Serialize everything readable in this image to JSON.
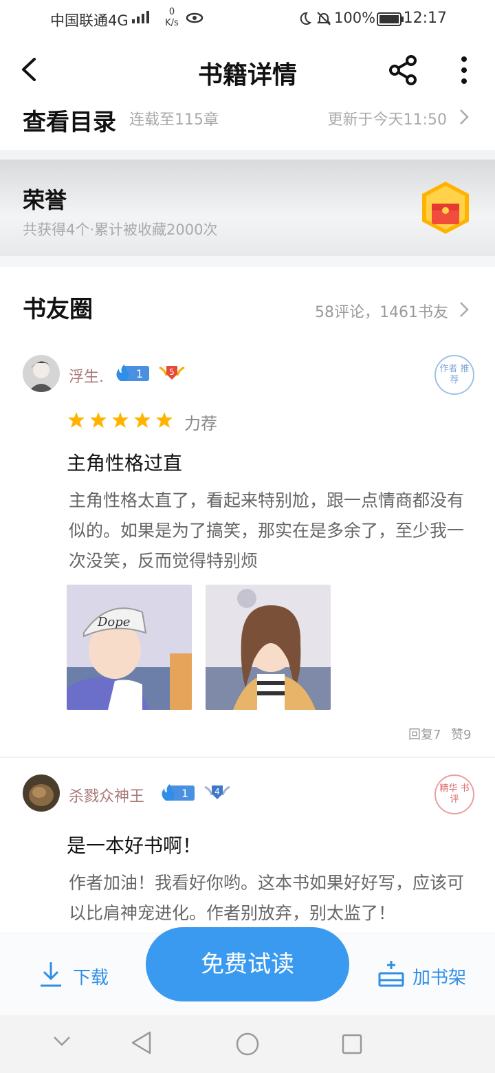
{
  "status_bar": {
    "carrier": "中国联通4G",
    "speed": "0 K/s",
    "battery": "100%",
    "time": "12:17"
  },
  "nav": {
    "title": "书籍详情"
  },
  "catalog": {
    "title": "查看目录",
    "progress": "连载至115章",
    "updated": "更新于今天11:50"
  },
  "honor": {
    "title": "荣誉",
    "summary": "共获得4个·累计被收藏2000次"
  },
  "circle": {
    "title": "书友圈",
    "stats": "58评论，1461书友"
  },
  "posts": [
    {
      "username": "浮生.",
      "level": "1",
      "badge": "5",
      "stamp": "作者 推荐",
      "rating_label": "力荐",
      "stars": 5,
      "title": "主角性格过直",
      "body": "主角性格太直了，看起来特别尬，跟一点情商都没有似的。如果是为了搞笑，那实在是多余了，至少我一次没笑，反而觉得特别烦",
      "replies": "回复7",
      "likes": "赞9"
    },
    {
      "username": "杀戮众神王",
      "level": "1",
      "badge": "4",
      "stamp": "精华 书评",
      "title": "是一本好书啊！",
      "body": "作者加油！我看好你哟。这本书如果好好写，应该可以比肩神宠进化。作者别放弃，别太监了！"
    }
  ],
  "bottom_bar": {
    "download": "下载",
    "read": "免费试读",
    "add_shelf": "加书架"
  },
  "colors": {
    "accent": "#3a9af0",
    "username": "#a77"
  }
}
